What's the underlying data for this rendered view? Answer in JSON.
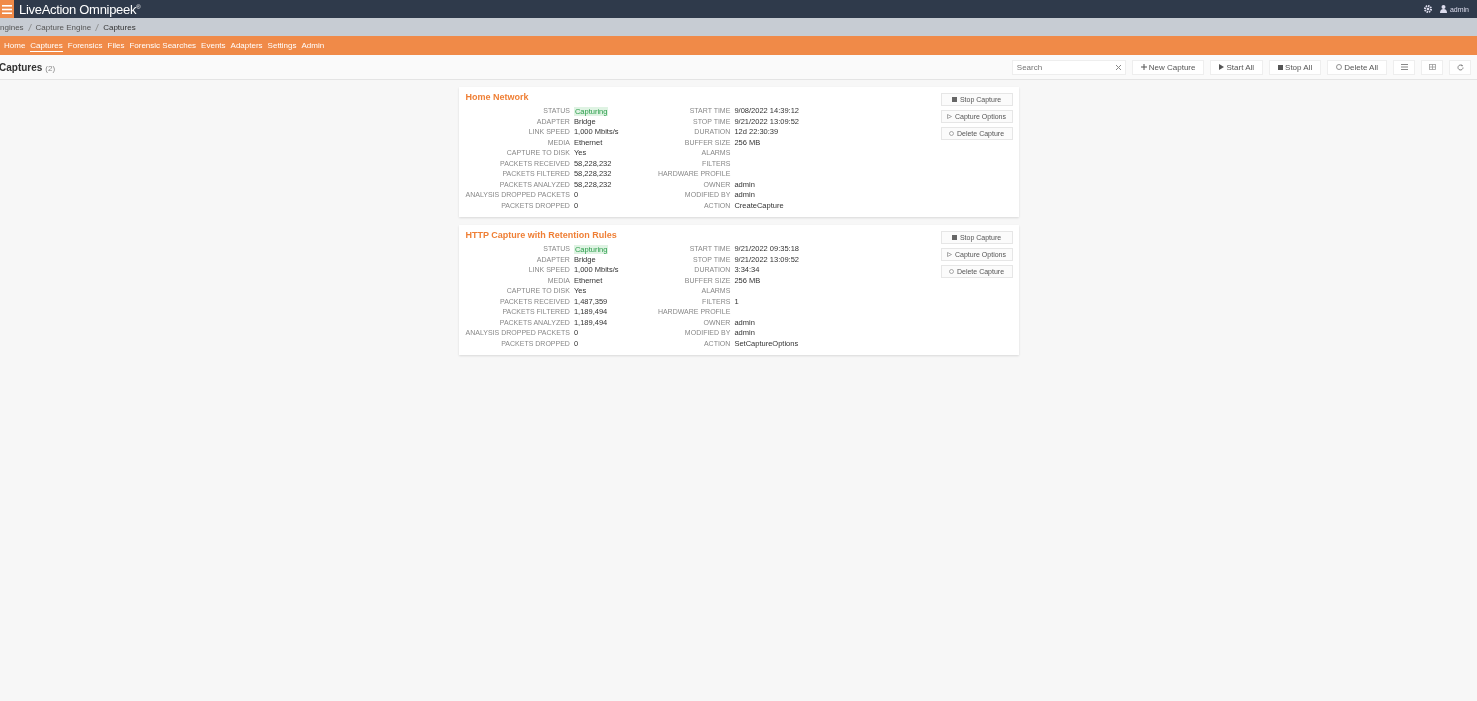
{
  "header": {
    "logo": "LiveAction Omnipeek",
    "logo_mark": "®",
    "user": "admin"
  },
  "breadcrumb": [
    "ngines",
    "Capture Engine",
    "Captures"
  ],
  "nav": [
    {
      "label": "Home",
      "selected": false
    },
    {
      "label": "Captures",
      "selected": true
    },
    {
      "label": "Forensics",
      "selected": false
    },
    {
      "label": "Files",
      "selected": false
    },
    {
      "label": "Forensic Searches",
      "selected": false
    },
    {
      "label": "Events",
      "selected": false
    },
    {
      "label": "Adapters",
      "selected": false
    },
    {
      "label": "Settings",
      "selected": false
    },
    {
      "label": "Admin",
      "selected": false
    }
  ],
  "page": {
    "title": "Captures",
    "count": "(2)"
  },
  "toolbar": {
    "search": {
      "placeholder": "Search"
    },
    "buttons": [
      {
        "kind": "new",
        "label": "New Capture"
      },
      {
        "kind": "start",
        "label": "Start All"
      },
      {
        "kind": "stop",
        "label": "Stop All"
      },
      {
        "kind": "delete",
        "label": "Delete All"
      }
    ]
  },
  "captures": [
    {
      "name": "Home Network",
      "left": [
        {
          "label": "STATUS",
          "value": "Capturing",
          "highlighted": true
        },
        {
          "label": "ADAPTER",
          "value": "Bridge",
          "highlighted": false
        },
        {
          "label": "LINK SPEED",
          "value": "1,000 Mbits/s",
          "highlighted": false
        },
        {
          "label": "MEDIA",
          "value": "Ethernet",
          "highlighted": false
        },
        {
          "label": "CAPTURE TO DISK",
          "value": "Yes",
          "highlighted": false
        },
        {
          "label": "PACKETS RECEIVED",
          "value": "58,228,232",
          "highlighted": false
        },
        {
          "label": "PACKETS FILTERED",
          "value": "58,228,232",
          "highlighted": false
        },
        {
          "label": "PACKETS ANALYZED",
          "value": "58,228,232",
          "highlighted": false
        },
        {
          "label": "ANALYSIS DROPPED PACKETS",
          "value": "0",
          "highlighted": false
        },
        {
          "label": "PACKETS DROPPED",
          "value": "0",
          "highlighted": false
        }
      ],
      "right": [
        {
          "label": "START TIME",
          "value": "9/08/2022 14:39:12",
          "highlighted": false
        },
        {
          "label": "STOP TIME",
          "value": "9/21/2022 13:09:52",
          "highlighted": false
        },
        {
          "label": "DURATION",
          "value": "12d 22:30:39",
          "highlighted": false
        },
        {
          "label": "BUFFER SIZE",
          "value": "256 MB",
          "highlighted": false
        },
        {
          "label": "ALARMS"
        },
        {
          "label": "FILTERS"
        },
        {
          "label": "HARDWARE PROFILE"
        },
        {
          "label": "OWNER",
          "value": "admin",
          "highlighted": false
        },
        {
          "label": "MODIFIED BY",
          "value": "admin",
          "highlighted": false
        },
        {
          "label": "ACTION",
          "value": "CreateCapture",
          "highlighted": false
        }
      ],
      "actions": [
        {
          "kind": "stop",
          "label": "Stop Capture"
        },
        {
          "kind": "options",
          "label": "Capture Options"
        },
        {
          "kind": "delete",
          "label": "Delete Capture"
        }
      ]
    },
    {
      "name": "HTTP Capture with Retention Rules",
      "left": [
        {
          "label": "STATUS",
          "value": "Capturing",
          "highlighted": true
        },
        {
          "label": "ADAPTER",
          "value": "Bridge",
          "highlighted": false
        },
        {
          "label": "LINK SPEED",
          "value": "1,000 Mbits/s",
          "highlighted": false
        },
        {
          "label": "MEDIA",
          "value": "Ethernet",
          "highlighted": false
        },
        {
          "label": "CAPTURE TO DISK",
          "value": "Yes",
          "highlighted": false
        },
        {
          "label": "PACKETS RECEIVED",
          "value": "1,487,359",
          "highlighted": false
        },
        {
          "label": "PACKETS FILTERED",
          "value": "1,189,494",
          "highlighted": false
        },
        {
          "label": "PACKETS ANALYZED",
          "value": "1,189,494",
          "highlighted": false
        },
        {
          "label": "ANALYSIS DROPPED PACKETS",
          "value": "0",
          "highlighted": false
        },
        {
          "label": "PACKETS DROPPED",
          "value": "0",
          "highlighted": false
        }
      ],
      "right": [
        {
          "label": "START TIME",
          "value": "9/21/2022 09:35:18",
          "highlighted": false
        },
        {
          "label": "STOP TIME",
          "value": "9/21/2022 13:09:52",
          "highlighted": false
        },
        {
          "label": "DURATION",
          "value": "3:34:34",
          "highlighted": false
        },
        {
          "label": "BUFFER SIZE",
          "value": "256 MB",
          "highlighted": false
        },
        {
          "label": "ALARMS"
        },
        {
          "label": "FILTERS",
          "value": "1",
          "highlighted": false
        },
        {
          "label": "HARDWARE PROFILE"
        },
        {
          "label": "OWNER",
          "value": "admin",
          "highlighted": false
        },
        {
          "label": "MODIFIED BY",
          "value": "admin",
          "highlighted": false
        },
        {
          "label": "ACTION",
          "value": "SetCaptureOptions",
          "highlighted": false
        }
      ],
      "actions": [
        {
          "kind": "stop",
          "label": "Stop Capture"
        },
        {
          "kind": "options",
          "label": "Capture Options"
        },
        {
          "kind": "delete",
          "label": "Delete Capture"
        }
      ]
    }
  ]
}
